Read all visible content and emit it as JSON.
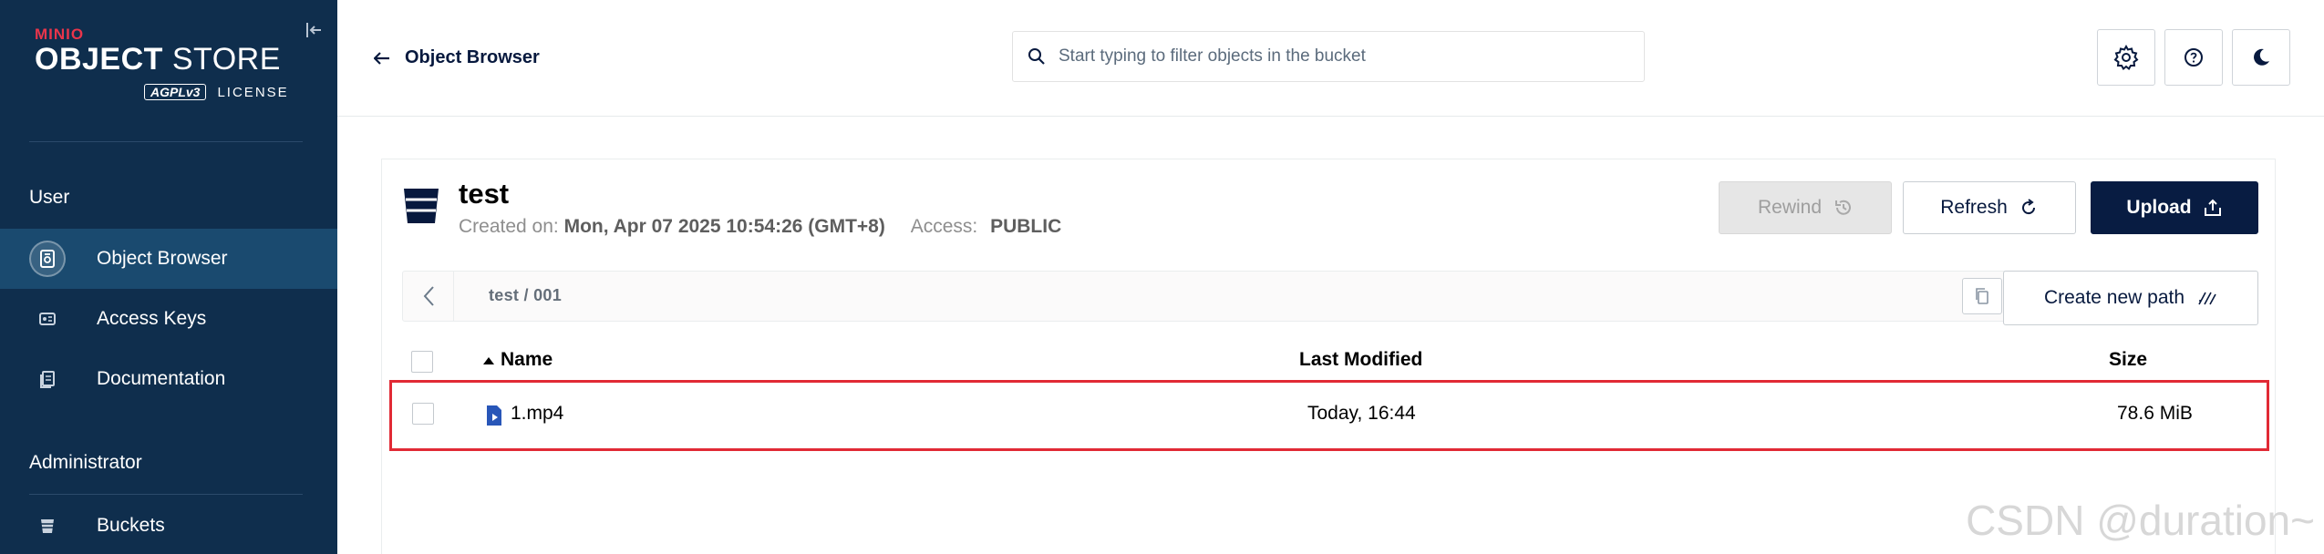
{
  "sidebar": {
    "logo": {
      "brand": "MINIO",
      "title_bold": "OBJECT",
      "title_thin": "STORE",
      "license_badge": "AGPLv3",
      "license_label": "LICENSE"
    },
    "sections": [
      {
        "label": "User",
        "items": [
          {
            "label": "Object Browser",
            "icon": "object-browser-icon",
            "active": true
          },
          {
            "label": "Access Keys",
            "icon": "access-keys-icon"
          },
          {
            "label": "Documentation",
            "icon": "documentation-icon"
          }
        ]
      },
      {
        "label": "Administrator",
        "items": [
          {
            "label": "Buckets",
            "icon": "buckets-icon"
          }
        ]
      }
    ]
  },
  "header": {
    "back_label": "Object Browser",
    "search_placeholder": "Start typing to filter objects in the bucket"
  },
  "bucket": {
    "name": "test",
    "created_label": "Created on:",
    "created_value": "Mon, Apr 07 2025 10:54:26 (GMT+8)",
    "access_label": "Access:",
    "access_value": "PUBLIC"
  },
  "actions": {
    "rewind": "Rewind",
    "refresh": "Refresh",
    "upload": "Upload",
    "create_path": "Create new path"
  },
  "breadcrumb": {
    "path": "test / 001"
  },
  "table": {
    "columns": [
      "Name",
      "Last Modified",
      "Size"
    ],
    "rows": [
      {
        "name": "1.mp4",
        "modified": "Today, 16:44",
        "size": "78.6 MiB"
      }
    ]
  },
  "watermark": "CSDN @duration~"
}
